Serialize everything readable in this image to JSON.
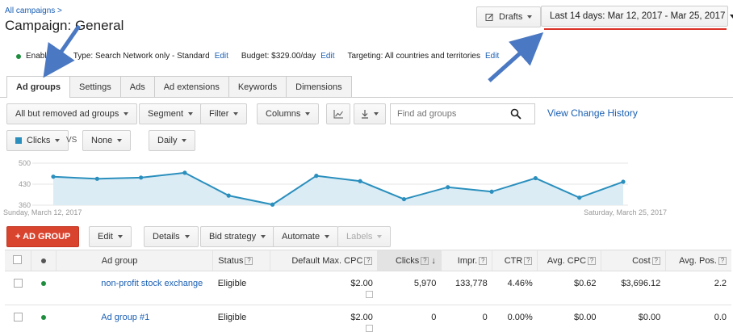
{
  "header": {
    "breadcrumb": "All campaigns >",
    "title_prefix": "Campaign: ",
    "title_name": "General",
    "drafts_label": "Drafts",
    "date_range": "Last 14 days: Mar 12, 2017 - Mar 25, 2017"
  },
  "status_bar": {
    "status": "Enabled",
    "type_label": "Type: Search Network only - Standard",
    "type_edit": "Edit",
    "budget_label": "Budget: $329.00/day",
    "budget_edit": "Edit",
    "targeting_label": "Targeting: All countries and territories",
    "targeting_edit": "Edit"
  },
  "tabs": [
    {
      "label": "Ad groups",
      "active": true
    },
    {
      "label": "Settings"
    },
    {
      "label": "Ads"
    },
    {
      "label": "Ad extensions"
    },
    {
      "label": "Keywords"
    },
    {
      "label": "Dimensions"
    }
  ],
  "toolbar": {
    "filter_scope": "All but removed ad groups",
    "segment": "Segment",
    "filter": "Filter",
    "columns": "Columns",
    "search_placeholder": "Find ad groups",
    "history": "View Change History"
  },
  "chart_controls": {
    "metric1": "Clicks",
    "vs": "VS",
    "metric2": "None",
    "granularity": "Daily"
  },
  "chart_data": {
    "type": "line",
    "series": [
      {
        "name": "Clicks",
        "values": [
          455,
          448,
          452,
          468,
          392,
          362,
          458,
          440,
          380,
          420,
          405,
          450,
          385,
          438
        ]
      }
    ],
    "ylim": [
      360,
      500
    ],
    "yticks": [
      "500",
      "430",
      "360"
    ],
    "x_start_label": "Sunday, March 12, 2017",
    "x_end_label": "Saturday, March 25, 2017",
    "color": "#2a8fbd"
  },
  "actions": {
    "add_group": "+ AD GROUP",
    "edit": "Edit",
    "details": "Details",
    "bid_strategy": "Bid strategy",
    "automate": "Automate",
    "labels": "Labels"
  },
  "table": {
    "columns": {
      "ad_group": "Ad group",
      "status": "Status",
      "max_cpc": "Default Max. CPC",
      "clicks": "Clicks",
      "impr": "Impr.",
      "ctr": "CTR",
      "avg_cpc": "Avg. CPC",
      "cost": "Cost",
      "avg_pos": "Avg. Pos."
    },
    "rows": [
      {
        "name": "non-profit stock exchange",
        "status": "Eligible",
        "max_cpc": "$2.00",
        "clicks": "5,970",
        "impr": "133,778",
        "ctr": "4.46%",
        "avg_cpc": "$0.62",
        "cost": "$3,696.12",
        "avg_pos": "2.2"
      },
      {
        "name": "Ad group #1",
        "status": "Eligible",
        "max_cpc": "$2.00",
        "clicks": "0",
        "impr": "0",
        "ctr": "0.00%",
        "avg_cpc": "$0.00",
        "cost": "$0.00",
        "avg_pos": "0.0"
      }
    ]
  }
}
